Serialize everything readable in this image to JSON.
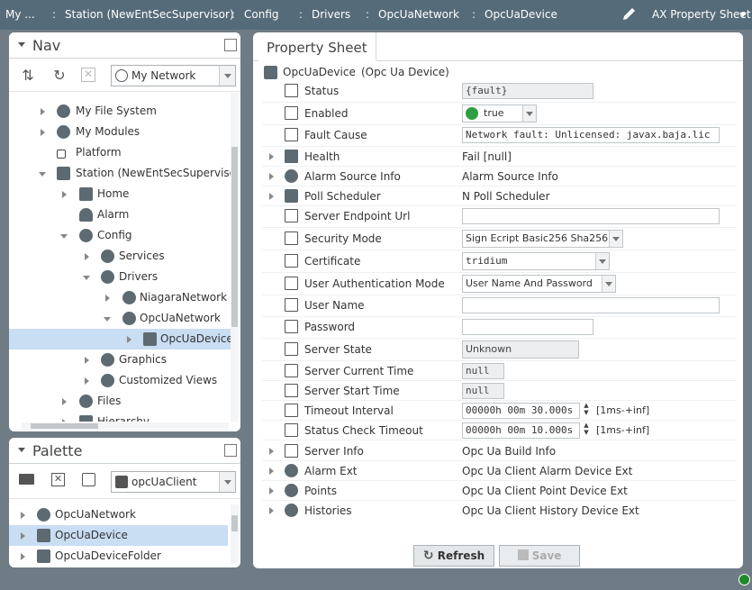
{
  "topbar": {
    "crumbs": [
      "My ...",
      "Station (NewEntSecSupervisor)",
      "Config",
      "Drivers",
      "OpcUaNetwork",
      "OpcUaDevice"
    ],
    "view_name": "AX Property Sheet",
    "edit_icon": "pencil-icon"
  },
  "nav": {
    "title": "Nav",
    "combo_value": "My Network",
    "tree": [
      {
        "label": "My File System",
        "icon": "filesystem-icon"
      },
      {
        "label": "My Modules",
        "icon": "modules-icon"
      },
      {
        "label": "Platform",
        "icon": "platform-icon"
      },
      {
        "label": "Station (NewEntSecSupervisor)",
        "icon": "station-icon"
      },
      {
        "label": "Home",
        "icon": "home-icon"
      },
      {
        "label": "Alarm",
        "icon": "bell-icon"
      },
      {
        "label": "Config",
        "icon": "config-icon"
      },
      {
        "label": "Services",
        "icon": "services-icon"
      },
      {
        "label": "Drivers",
        "icon": "drivers-icon"
      },
      {
        "label": "NiagaraNetwork",
        "icon": "network-icon"
      },
      {
        "label": "OpcUaNetwork",
        "icon": "network-icon"
      },
      {
        "label": "OpcUaDevice",
        "icon": "device-icon"
      },
      {
        "label": "Graphics",
        "icon": "graphics-icon"
      },
      {
        "label": "Customized Views",
        "icon": "views-icon"
      },
      {
        "label": "Files",
        "icon": "files-icon"
      },
      {
        "label": "Hierarchy",
        "icon": "hierarchy-icon"
      }
    ]
  },
  "palette": {
    "title": "Palette",
    "combo_value": "opcUaClient",
    "items": [
      {
        "label": "OpcUaNetwork"
      },
      {
        "label": "OpcUaDevice"
      },
      {
        "label": "OpcUaDeviceFolder"
      }
    ]
  },
  "props": {
    "tab": "Property Sheet",
    "header_name": "OpcUaDevice",
    "header_type": "(Opc Ua Device)",
    "rows": [
      {
        "name": "Status",
        "value": "{fault}"
      },
      {
        "name": "Enabled",
        "value": "true"
      },
      {
        "name": "Fault Cause",
        "value": "Network fault: Unlicensed: javax.baja.lic"
      },
      {
        "name": "Health",
        "value": "Fail [null]"
      },
      {
        "name": "Alarm Source Info",
        "value": "Alarm Source Info"
      },
      {
        "name": "Poll Scheduler",
        "value": "N Poll Scheduler"
      },
      {
        "name": "Server Endpoint Url",
        "value": ""
      },
      {
        "name": "Security Mode",
        "value": "Sign Ecript Basic256 Sha256"
      },
      {
        "name": "Certificate",
        "value": "tridium"
      },
      {
        "name": "User Authentication Mode",
        "value": "User Name And Password"
      },
      {
        "name": "User Name",
        "value": ""
      },
      {
        "name": "Password",
        "value": ""
      },
      {
        "name": "Server State",
        "value": "Unknown"
      },
      {
        "name": "Server Current Time",
        "value": "null"
      },
      {
        "name": "Server Start Time",
        "value": "null"
      },
      {
        "name": "Timeout Interval",
        "value": "00000h 00m 30.000s",
        "range": "[1ms-+inf]"
      },
      {
        "name": "Status Check Timeout",
        "value": "00000h 00m 10.000s",
        "range": "[1ms-+inf]"
      },
      {
        "name": "Server Info",
        "value": "Opc Ua Build Info"
      },
      {
        "name": "Alarm Ext",
        "value": "Opc Ua Client Alarm Device Ext"
      },
      {
        "name": "Points",
        "value": "Opc Ua Client Point Device Ext"
      },
      {
        "name": "Histories",
        "value": "Opc Ua Client History Device Ext"
      }
    ],
    "refresh_label": "Refresh",
    "save_label": "Save"
  },
  "colors": {
    "topbar": "#566b7a",
    "background": "#6f7c85",
    "selection": "#c9ddf3",
    "ok_green": "#1e8a2a"
  }
}
